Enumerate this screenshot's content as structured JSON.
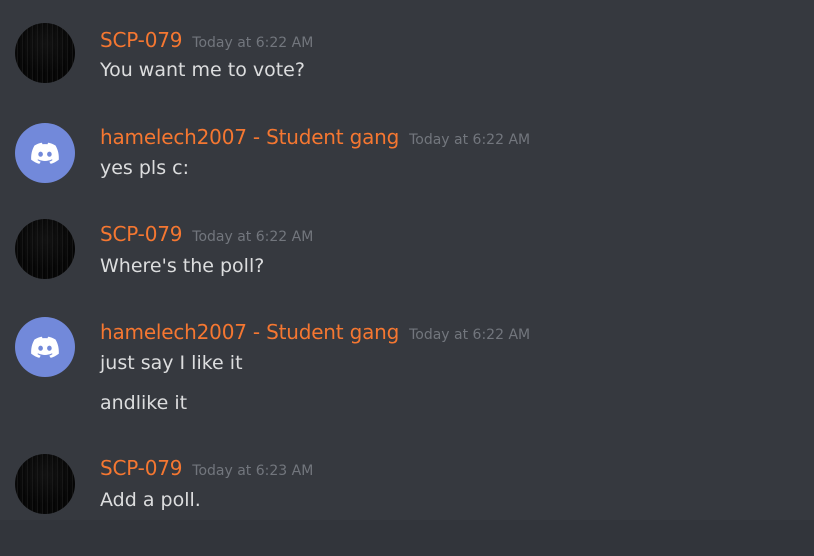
{
  "colors": {
    "background": "#36393f",
    "username": "#f57731",
    "timestamp": "#72767d",
    "message_text": "#dcddde",
    "discord_avatar": "#7289da"
  },
  "messages": [
    {
      "author": "SCP-079",
      "avatar_icon": "dark-static-avatar",
      "timestamp": "Today at 6:22 AM",
      "lines": [
        "You want me to vote?"
      ]
    },
    {
      "author": "hamelech2007 - Student gang",
      "avatar_icon": "discord-logo-avatar",
      "timestamp": "Today at 6:22 AM",
      "lines": [
        "yes pls c:"
      ]
    },
    {
      "author": "SCP-079",
      "avatar_icon": "dark-static-avatar",
      "timestamp": "Today at 6:22 AM",
      "lines": [
        "Where's the poll?"
      ]
    },
    {
      "author": "hamelech2007 - Student gang",
      "avatar_icon": "discord-logo-avatar",
      "timestamp": "Today at 6:22 AM",
      "lines": [
        "just say I like it",
        "andlike it"
      ]
    },
    {
      "author": "SCP-079",
      "avatar_icon": "dark-static-avatar",
      "timestamp": "Today at 6:23 AM",
      "lines": [
        "Add a poll."
      ]
    }
  ]
}
